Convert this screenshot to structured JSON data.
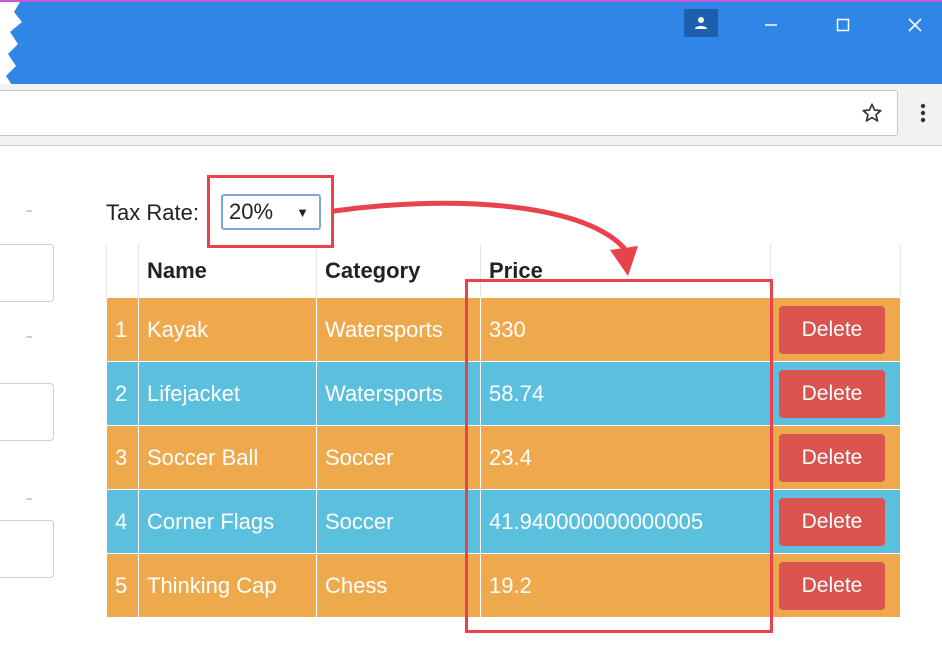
{
  "browser": {
    "accent_color": "#2f86e6",
    "icons": [
      "profile-icon",
      "minimize-icon",
      "maximize-icon",
      "close-icon",
      "star-icon",
      "more-vert-icon"
    ]
  },
  "tax_rate": {
    "label": "Tax Rate:",
    "selected": "20%"
  },
  "table": {
    "headers": [
      "",
      "Name",
      "Category",
      "Price",
      ""
    ],
    "rows": [
      {
        "num": "1",
        "name": "Kayak",
        "category": "Watersports",
        "price": "330",
        "action": "Delete"
      },
      {
        "num": "2",
        "name": "Lifejacket",
        "category": "Watersports",
        "price": "58.74",
        "action": "Delete"
      },
      {
        "num": "3",
        "name": "Soccer Ball",
        "category": "Soccer",
        "price": "23.4",
        "action": "Delete"
      },
      {
        "num": "4",
        "name": "Corner Flags",
        "category": "Soccer",
        "price": "41.940000000000005",
        "action": "Delete"
      },
      {
        "num": "5",
        "name": "Thinking Cap",
        "category": "Chess",
        "price": "19.2",
        "action": "Delete"
      }
    ],
    "row_colors": [
      "#efa94d",
      "#5bc0de"
    ],
    "delete_color": "#d9534f"
  },
  "annotation_color": "#e8424d"
}
